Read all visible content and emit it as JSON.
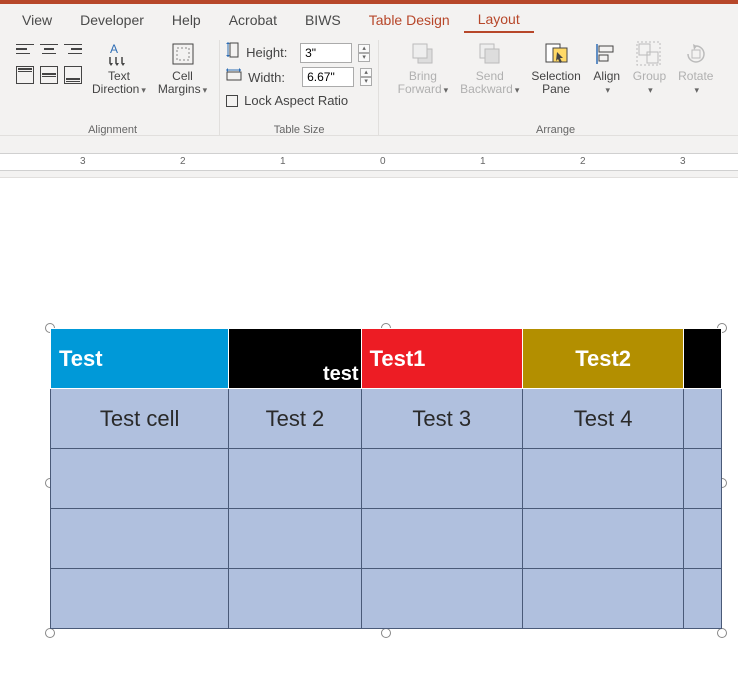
{
  "menu": {
    "view": "View",
    "developer": "Developer",
    "help": "Help",
    "acrobat": "Acrobat",
    "biws": "BIWS",
    "table_design": "Table Design",
    "layout": "Layout"
  },
  "ribbon": {
    "alignment": {
      "text_direction": "Text\nDirection",
      "cell_margins": "Cell\nMargins",
      "group_label": "Alignment"
    },
    "table_size": {
      "height_label": "Height:",
      "height_value": "3\"",
      "width_label": "Width:",
      "width_value": "6.67\"",
      "lock_label": "Lock Aspect Ratio",
      "group_label": "Table Size"
    },
    "arrange": {
      "bring_forward": "Bring\nForward",
      "send_backward": "Send\nBackward",
      "selection_pane": "Selection\nPane",
      "align": "Align",
      "group": "Group",
      "rotate": "Rotate",
      "group_label": "Arrange"
    }
  },
  "ruler": {
    "marks": [
      "3",
      "2",
      "1",
      "0",
      "1",
      "2",
      "3"
    ]
  },
  "table": {
    "headers": [
      "Test",
      "test",
      "Test1",
      "Test2",
      ""
    ],
    "rows": [
      [
        "Test cell",
        "Test 2",
        "Test 3",
        "Test 4",
        ""
      ],
      [
        "",
        "",
        "",
        "",
        ""
      ],
      [
        "",
        "",
        "",
        "",
        ""
      ],
      [
        "",
        "",
        "",
        "",
        ""
      ]
    ]
  }
}
